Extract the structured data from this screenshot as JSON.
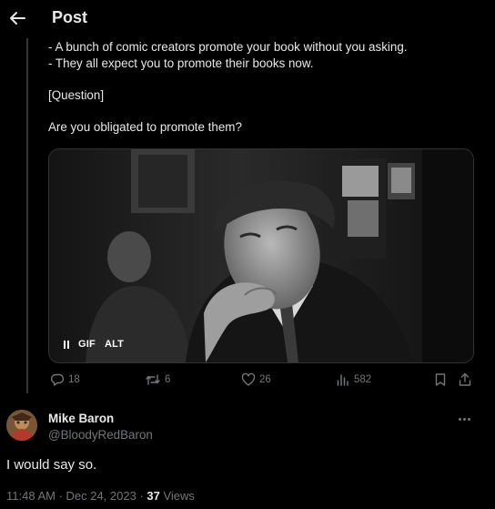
{
  "header": {
    "title": "Post",
    "back_icon": "arrow-left-icon"
  },
  "post": {
    "lines": [
      "- A bunch of comic creators promote your book without you asking.",
      "- They all expect you to promote their books now.",
      "[Question]",
      "Are you obligated to promote them?"
    ],
    "media": {
      "controls": {
        "pause_icon": "pause-icon",
        "gif_label": "GIF",
        "alt_label": "ALT"
      }
    },
    "actions": {
      "replies": {
        "icon": "reply-icon",
        "count": "18"
      },
      "reposts": {
        "icon": "repost-icon",
        "count": "6"
      },
      "likes": {
        "icon": "heart-icon",
        "count": "26"
      },
      "views": {
        "icon": "analytics-icon",
        "count": "582"
      },
      "bookmark_icon": "bookmark-icon",
      "share_icon": "share-icon"
    }
  },
  "reply": {
    "name": "Mike Baron",
    "handle": "@BloodyRedBaron",
    "more_icon": "more-icon",
    "text": "I would say so.",
    "timestamp": "11:48 AM · Dec 24, 2023 · ",
    "views_count": "37",
    "views_label": " Views"
  },
  "colors": {
    "background": "#000000",
    "text_primary": "#e7e9ea",
    "text_secondary": "#71767b",
    "border": "#2f3336"
  }
}
